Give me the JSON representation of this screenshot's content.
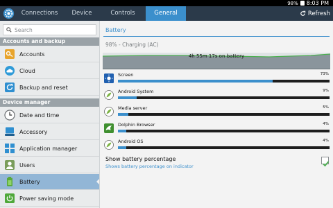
{
  "status_bar": {
    "battery_text": "98%",
    "time": "8:03 PM"
  },
  "tabs": [
    {
      "label": "Connections",
      "active": false
    },
    {
      "label": "Device",
      "active": false
    },
    {
      "label": "Controls",
      "active": false
    },
    {
      "label": "General",
      "active": true
    }
  ],
  "refresh_label": "Refresh",
  "sidebar": {
    "search_placeholder": "Search",
    "sections": [
      {
        "title": "Accounts and backup"
      },
      {
        "title": "Device manager"
      }
    ],
    "items": [
      {
        "label": "Accounts",
        "icon": "key-icon",
        "active": false
      },
      {
        "label": "Cloud",
        "icon": "cloud-icon",
        "active": false
      },
      {
        "label": "Backup and reset",
        "icon": "backup-icon",
        "active": false
      },
      {
        "label": "Date and time",
        "icon": "clock-icon",
        "active": false
      },
      {
        "label": "Accessory",
        "icon": "accessory-icon",
        "active": false
      },
      {
        "label": "Application manager",
        "icon": "grid-icon",
        "active": false
      },
      {
        "label": "Users",
        "icon": "user-icon",
        "active": false
      },
      {
        "label": "Battery",
        "icon": "battery-icon",
        "active": true
      },
      {
        "label": "Power saving mode",
        "icon": "power-saving-icon",
        "active": false
      }
    ]
  },
  "main": {
    "title": "Battery",
    "status": "98% - Charging (AC)",
    "graph_label": "4h 55m 17s on battery",
    "apps": [
      {
        "name": "Screen",
        "percent_text": "73%",
        "fraction": 0.73,
        "icon": "screen-brightness-icon"
      },
      {
        "name": "Android System",
        "percent_text": "9%",
        "fraction": 0.09,
        "icon": "android-system-icon"
      },
      {
        "name": "Media server",
        "percent_text": "5%",
        "fraction": 0.05,
        "icon": "media-server-icon"
      },
      {
        "name": "Dolphin Browser",
        "percent_text": "4%",
        "fraction": 0.04,
        "icon": "dolphin-browser-icon"
      },
      {
        "name": "Android OS",
        "percent_text": "4%",
        "fraction": 0.04,
        "icon": "android-os-icon"
      }
    ],
    "setting": {
      "title": "Show battery percentage",
      "subtitle": "Shows battery percentage on indicator",
      "checked": true
    }
  },
  "colors": {
    "accent": "#3b8fcc",
    "tabbar": "#2b3a4a",
    "graph_fill": "#8a959c",
    "graph_line": "#4caf50"
  }
}
